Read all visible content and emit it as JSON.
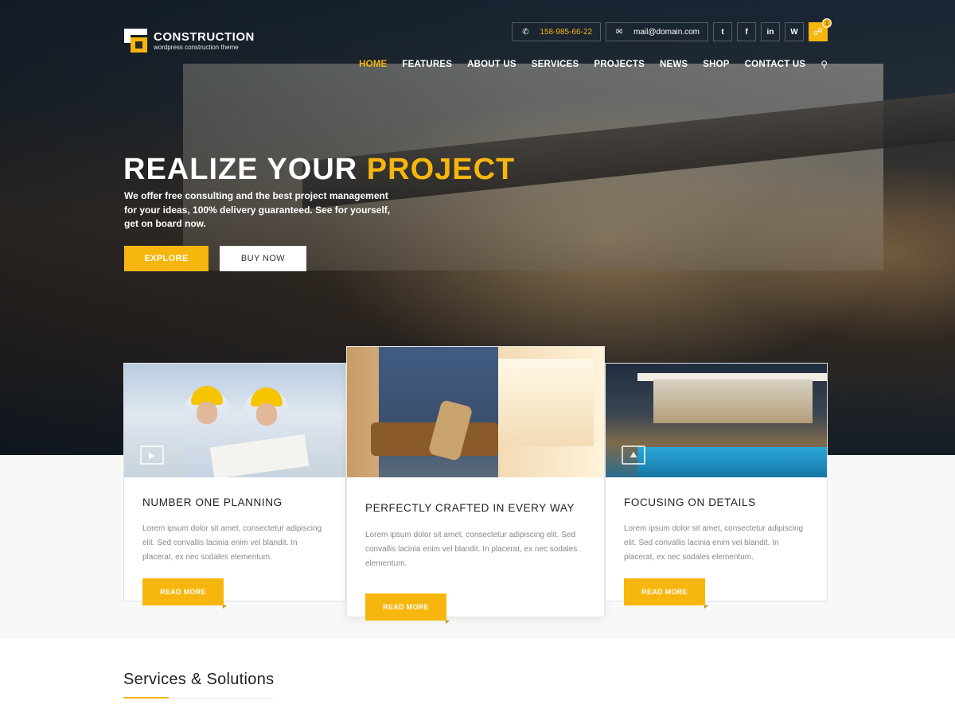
{
  "brand": {
    "name": "CONSTRUCTION",
    "tagline": "wordpress construction theme"
  },
  "topbar": {
    "phone": "158-985-66-22",
    "email": "mail@domain.com",
    "socials": [
      {
        "label": "t",
        "icon": "twitter-icon"
      },
      {
        "label": "f",
        "icon": "facebook-icon"
      },
      {
        "label": "in",
        "icon": "linkedin-icon"
      },
      {
        "label": "W",
        "icon": "wordpress-icon"
      }
    ],
    "cart_count": "1"
  },
  "nav": {
    "items": [
      "HOME",
      "FEATURES",
      "ABOUT US",
      "SERVICES",
      "PROJECTS",
      "NEWS",
      "SHOP",
      "CONTACT US"
    ],
    "active": "HOME"
  },
  "hero": {
    "title_part1": "REALIZE YOUR",
    "title_part2": "PROJECT",
    "subtitle": "We offer free consulting and the best project management for your ideas, 100% delivery guaranteed. See for yourself, get on board now.",
    "btn_primary": "EXPLORE",
    "btn_secondary": "BUY NOW"
  },
  "cards": [
    {
      "title": "NUMBER ONE PLANNING",
      "text": "Lorem ipsum dolor sit amet, consectetur adipiscing elit. Sed convallis lacinia enim vel blandit. In placerat, ex nec sodales elementum.",
      "button": "READ MORE"
    },
    {
      "title": "PERFECTLY CRAFTED IN EVERY WAY",
      "text": "Lorem ipsum dolor sit amet, consectetur adipiscing elit. Sed convallis lacinia enim vel blandit. In placerat, ex nec sodales elementum.",
      "button": "READ MORE"
    },
    {
      "title": "FOCUSING ON DETAILS",
      "text": "Lorem ipsum dolor sit amet, consectetur adipiscing elit. Sed convallis lacinia enim vel blandit. In placerat, ex nec sodales elementum.",
      "button": "READ MORE"
    }
  ],
  "services": {
    "title": "Services & Solutions"
  },
  "colors": {
    "accent": "#f7b60d",
    "band": "#f7f8f7"
  }
}
